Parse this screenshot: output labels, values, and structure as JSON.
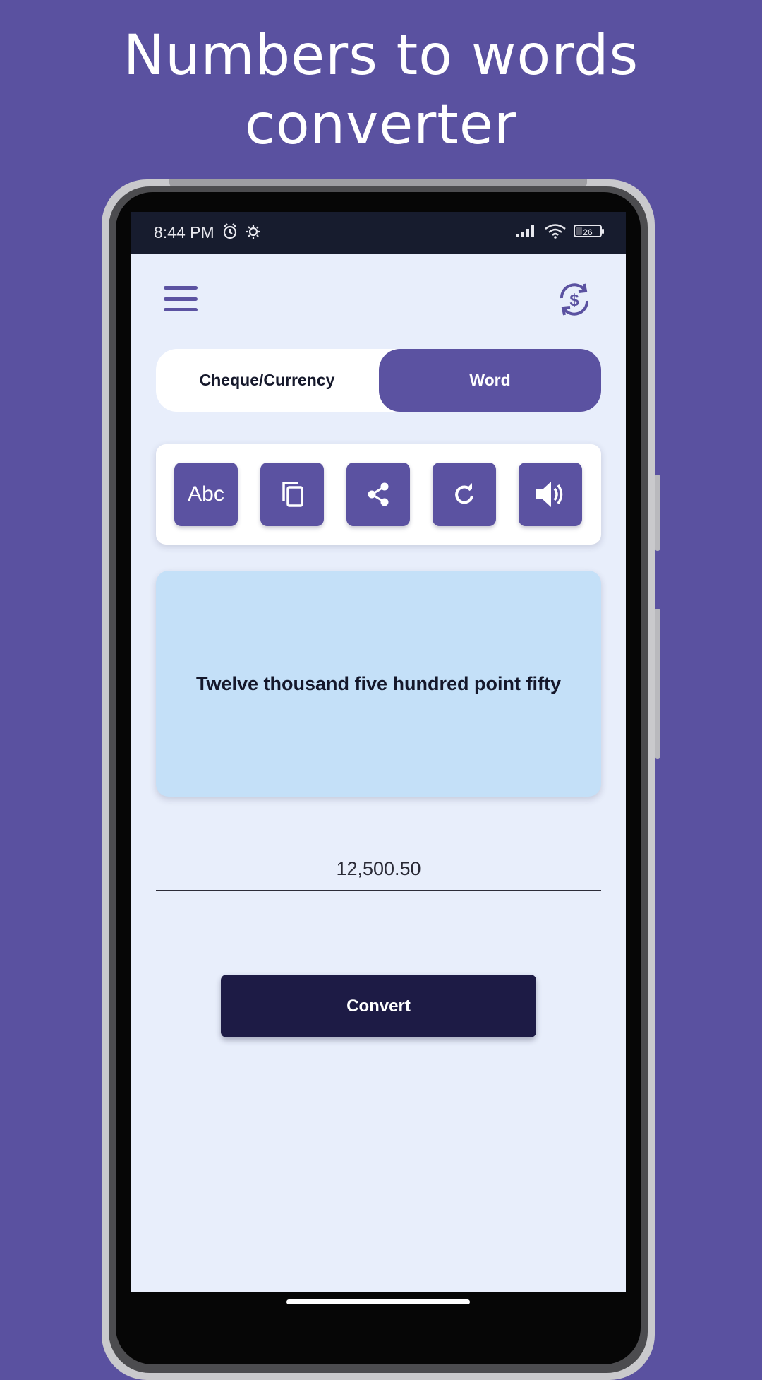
{
  "promo": {
    "line1": "Numbers to words",
    "line2": "converter"
  },
  "status_bar": {
    "time": "8:44 PM",
    "left_icons": [
      "alarm-icon",
      "settings-cog-icon"
    ],
    "right_icons": [
      "cellular-signal-icon",
      "wifi-icon",
      "battery-icon"
    ],
    "battery_level": "26"
  },
  "appbar": {
    "menu_icon": "hamburger-menu-icon",
    "action_icon": "currency-exchange-icon"
  },
  "mode_toggle": {
    "options": [
      "Cheque/Currency",
      "Word"
    ],
    "selected": "Word"
  },
  "toolbar": {
    "buttons": [
      {
        "name": "text-case",
        "label": "Abc"
      },
      {
        "name": "copy",
        "icon": "copy-icon"
      },
      {
        "name": "share",
        "icon": "share-icon"
      },
      {
        "name": "reset",
        "icon": "refresh-icon"
      },
      {
        "name": "speak",
        "icon": "speaker-icon"
      }
    ]
  },
  "result": {
    "text": "Twelve thousand five hundred point fifty"
  },
  "input": {
    "value": "12,500.50"
  },
  "convert_button": {
    "label": "Convert"
  },
  "colors": {
    "background": "#5a51a0",
    "accent": "#5b52a1",
    "screen": "#e8eefb",
    "result_card": "#c4e0f8",
    "convert_button": "#1d1b45"
  }
}
